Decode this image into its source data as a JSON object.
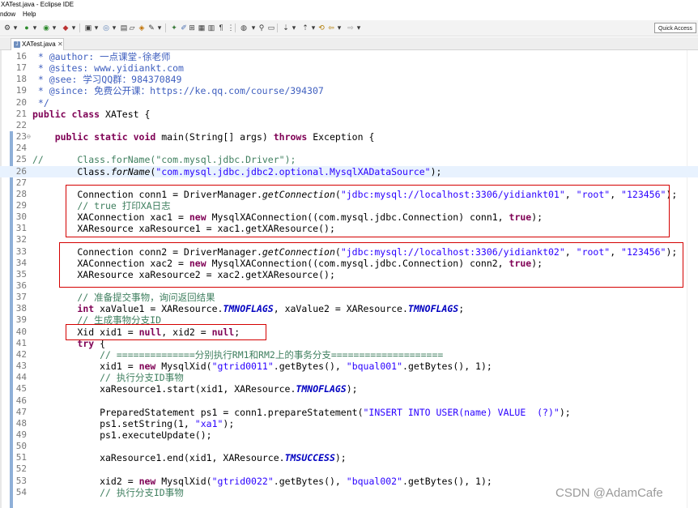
{
  "window": {
    "title": "XATest.java - Eclipse IDE"
  },
  "menu": [
    "ndow",
    "Help"
  ],
  "quick_access": "Quick Access",
  "tab": {
    "label": "XATest.java",
    "close": "✕"
  },
  "code_lines": [
    {
      "num": "16",
      "tokens": [
        {
          "c": "doc",
          "t": " * @author: "
        },
        {
          "c": "doc",
          "t": "一点课堂-徐老师"
        }
      ]
    },
    {
      "num": "17",
      "tokens": [
        {
          "c": "doc",
          "t": " * @sites: www.yidiankt.com"
        }
      ]
    },
    {
      "num": "18",
      "tokens": [
        {
          "c": "doc",
          "t": " * @see: "
        },
        {
          "c": "doc",
          "t": "学习QQ群：984370849"
        }
      ]
    },
    {
      "num": "19",
      "tokens": [
        {
          "c": "doc",
          "t": " * @since: "
        },
        {
          "c": "doc",
          "t": "免费公开课："
        },
        {
          "c": "doc",
          "t": "https://ke.qq.com/course/394307"
        }
      ]
    },
    {
      "num": "20",
      "tokens": [
        {
          "c": "doc",
          "t": " */"
        }
      ]
    },
    {
      "num": "21",
      "tokens": [
        {
          "c": "kw",
          "t": "public class"
        },
        {
          "c": "",
          "t": " XATest {"
        }
      ]
    },
    {
      "num": "22",
      "tokens": []
    },
    {
      "num": "23",
      "fold": "⊖",
      "tokens": [
        {
          "c": "",
          "t": "    "
        },
        {
          "c": "kw",
          "t": "public static void"
        },
        {
          "c": "",
          "t": " main(String[] args) "
        },
        {
          "c": "kw",
          "t": "throws"
        },
        {
          "c": "",
          "t": " Exception {"
        }
      ]
    },
    {
      "num": "24",
      "tokens": []
    },
    {
      "num": "25",
      "tokens": [
        {
          "c": "cm",
          "t": "//      Class.forName("
        },
        {
          "c": "cm",
          "t": "\"com.mysql.jdbc.Driver\");"
        }
      ]
    },
    {
      "num": "26",
      "hl": true,
      "tokens": [
        {
          "c": "",
          "t": "        Class."
        },
        {
          "c": "sm",
          "t": "forName"
        },
        {
          "c": "",
          "t": "("
        },
        {
          "c": "str",
          "t": "\"com.mysql.jdbc.jdbc2.optional.MysqlXADataSource\""
        },
        {
          "c": "",
          "t": ");"
        }
      ]
    },
    {
      "num": "27",
      "tokens": []
    },
    {
      "num": "28",
      "tokens": [
        {
          "c": "",
          "t": "        Connection conn1 = DriverManager."
        },
        {
          "c": "sm",
          "t": "getConnection"
        },
        {
          "c": "",
          "t": "("
        },
        {
          "c": "str",
          "t": "\"jdbc:mysql://localhost:3306/yidiankt01\""
        },
        {
          "c": "",
          "t": ", "
        },
        {
          "c": "str",
          "t": "\"root\""
        },
        {
          "c": "",
          "t": ", "
        },
        {
          "c": "str",
          "t": "\"123456\""
        },
        {
          "c": "",
          "t": ");"
        }
      ]
    },
    {
      "num": "29",
      "tokens": [
        {
          "c": "cm",
          "t": "        // true "
        },
        {
          "c": "cm",
          "t": "打印XA日志"
        }
      ]
    },
    {
      "num": "30",
      "tokens": [
        {
          "c": "",
          "t": "        XAConnection xac1 = "
        },
        {
          "c": "kw",
          "t": "new"
        },
        {
          "c": "",
          "t": " MysqlXAConnection((com.mysql.jdbc.Connection) conn1, "
        },
        {
          "c": "kw",
          "t": "true"
        },
        {
          "c": "",
          "t": ");"
        }
      ]
    },
    {
      "num": "31",
      "tokens": [
        {
          "c": "",
          "t": "        XAResource xaResource1 = xac1.getXAResource();"
        }
      ]
    },
    {
      "num": "32",
      "tokens": []
    },
    {
      "num": "33",
      "tokens": [
        {
          "c": "",
          "t": "        Connection conn2 = DriverManager."
        },
        {
          "c": "sm",
          "t": "getConnection"
        },
        {
          "c": "",
          "t": "("
        },
        {
          "c": "str",
          "t": "\"jdbc:mysql://localhost:3306/yidiankt02\""
        },
        {
          "c": "",
          "t": ", "
        },
        {
          "c": "str",
          "t": "\"root\""
        },
        {
          "c": "",
          "t": ", "
        },
        {
          "c": "str",
          "t": "\"123456\""
        },
        {
          "c": "",
          "t": ");"
        }
      ]
    },
    {
      "num": "34",
      "tokens": [
        {
          "c": "",
          "t": "        XAConnection xac2 = "
        },
        {
          "c": "kw",
          "t": "new"
        },
        {
          "c": "",
          "t": " MysqlXAConnection((com.mysql.jdbc.Connection) conn2, "
        },
        {
          "c": "kw",
          "t": "true"
        },
        {
          "c": "",
          "t": ");"
        }
      ]
    },
    {
      "num": "35",
      "tokens": [
        {
          "c": "",
          "t": "        XAResource xaResource2 = xac2.getXAResource();"
        }
      ]
    },
    {
      "num": "36",
      "tokens": []
    },
    {
      "num": "37",
      "tokens": [
        {
          "c": "cm",
          "t": "        // 准备提交事物，"
        },
        {
          "c": "cm",
          "t": "询问返回结果"
        }
      ]
    },
    {
      "num": "38",
      "tokens": [
        {
          "c": "",
          "t": "        "
        },
        {
          "c": "kw",
          "t": "int"
        },
        {
          "c": "",
          "t": " xaValue1 = XAResource."
        },
        {
          "c": "cn",
          "t": "TMNOFLAGS"
        },
        {
          "c": "",
          "t": ", xaValue2 = XAResource."
        },
        {
          "c": "cn",
          "t": "TMNOFLAGS"
        },
        {
          "c": "",
          "t": ";"
        }
      ]
    },
    {
      "num": "39",
      "tokens": [
        {
          "c": "cm",
          "t": "        // 生成事物分支ID"
        }
      ]
    },
    {
      "num": "40",
      "tokens": [
        {
          "c": "",
          "t": "        Xid xid1 = "
        },
        {
          "c": "kw",
          "t": "null"
        },
        {
          "c": "",
          "t": ", xid2 = "
        },
        {
          "c": "kw",
          "t": "null"
        },
        {
          "c": "",
          "t": ";"
        }
      ]
    },
    {
      "num": "41",
      "tokens": [
        {
          "c": "",
          "t": "        "
        },
        {
          "c": "kw",
          "t": "try"
        },
        {
          "c": "",
          "t": " {"
        }
      ]
    },
    {
      "num": "42",
      "tokens": [
        {
          "c": "cm",
          "t": "            // ==============分别执行RM1和RM2上的事务分支===================="
        }
      ]
    },
    {
      "num": "43",
      "tokens": [
        {
          "c": "",
          "t": "            xid1 = "
        },
        {
          "c": "kw",
          "t": "new"
        },
        {
          "c": "",
          "t": " MysqlXid("
        },
        {
          "c": "str",
          "t": "\"gtrid0011\""
        },
        {
          "c": "",
          "t": ".getBytes(), "
        },
        {
          "c": "str",
          "t": "\"bqual001\""
        },
        {
          "c": "",
          "t": ".getBytes(), 1);"
        }
      ]
    },
    {
      "num": "44",
      "tokens": [
        {
          "c": "cm",
          "t": "            // 执行分支ID事物"
        }
      ]
    },
    {
      "num": "45",
      "tokens": [
        {
          "c": "",
          "t": "            xaResource1.start(xid1, XAResource."
        },
        {
          "c": "cn",
          "t": "TMNOFLAGS"
        },
        {
          "c": "",
          "t": ");"
        }
      ]
    },
    {
      "num": "46",
      "tokens": []
    },
    {
      "num": "47",
      "tokens": [
        {
          "c": "",
          "t": "            PreparedStatement ps1 = conn1.prepareStatement("
        },
        {
          "c": "str",
          "t": "\"INSERT INTO USER(name) VALUE  (?)\""
        },
        {
          "c": "",
          "t": ");"
        }
      ]
    },
    {
      "num": "48",
      "tokens": [
        {
          "c": "",
          "t": "            ps1.setString(1, "
        },
        {
          "c": "str",
          "t": "\"xa1\""
        },
        {
          "c": "",
          "t": ");"
        }
      ]
    },
    {
      "num": "49",
      "tokens": [
        {
          "c": "",
          "t": "            ps1.executeUpdate();"
        }
      ]
    },
    {
      "num": "50",
      "tokens": []
    },
    {
      "num": "51",
      "tokens": [
        {
          "c": "",
          "t": "            xaResource1.end(xid1, XAResource."
        },
        {
          "c": "cn",
          "t": "TMSUCCESS"
        },
        {
          "c": "",
          "t": ");"
        }
      ]
    },
    {
      "num": "52",
      "tokens": []
    },
    {
      "num": "53",
      "tokens": [
        {
          "c": "",
          "t": "            xid2 = "
        },
        {
          "c": "kw",
          "t": "new"
        },
        {
          "c": "",
          "t": " MysqlXid("
        },
        {
          "c": "str",
          "t": "\"gtrid0022\""
        },
        {
          "c": "",
          "t": ".getBytes(), "
        },
        {
          "c": "str",
          "t": "\"bqual002\""
        },
        {
          "c": "",
          "t": ".getBytes(), 1);"
        }
      ]
    },
    {
      "num": "54",
      "tokens": [
        {
          "c": "cm",
          "t": "            // 执行分支ID事物"
        }
      ]
    }
  ],
  "watermark": "CSDN @AdamCafe",
  "colors": {
    "keyword": "#7f0055",
    "string": "#2a00ff",
    "comment": "#3f7f5f",
    "javadoc": "#3f5fbf",
    "constant": "#0000c0",
    "highlight_box": "#d40000"
  }
}
